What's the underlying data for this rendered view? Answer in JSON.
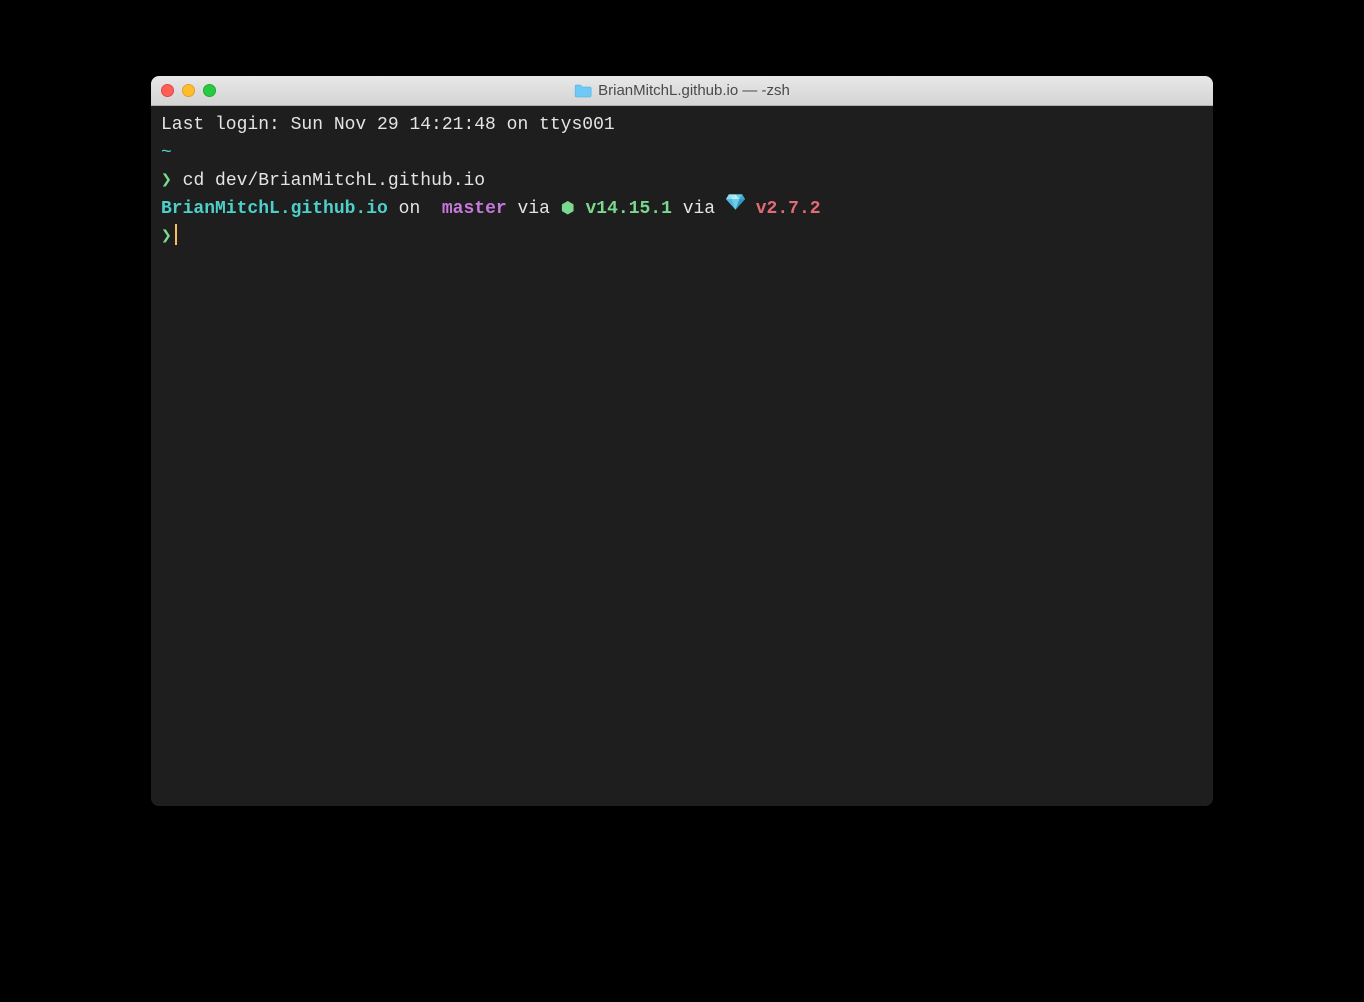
{
  "window": {
    "title": "BrianMitchL.github.io — -zsh"
  },
  "terminal": {
    "last_login": "Last login: Sun Nov 29 14:21:48 on ttys001",
    "home_symbol": "~",
    "prompt_arrow": "❯",
    "cd_command": "cd dev/BrianMitchL.github.io",
    "repo_name": "BrianMitchL.github.io",
    "on_text": " on ",
    "branch_symbol": "",
    "branch_name": "master",
    "via_text_1": " via ",
    "node_symbol": "⬢",
    "node_version": "v14.15.1",
    "via_text_2": " via ",
    "ruby_version": "v2.7.2"
  }
}
